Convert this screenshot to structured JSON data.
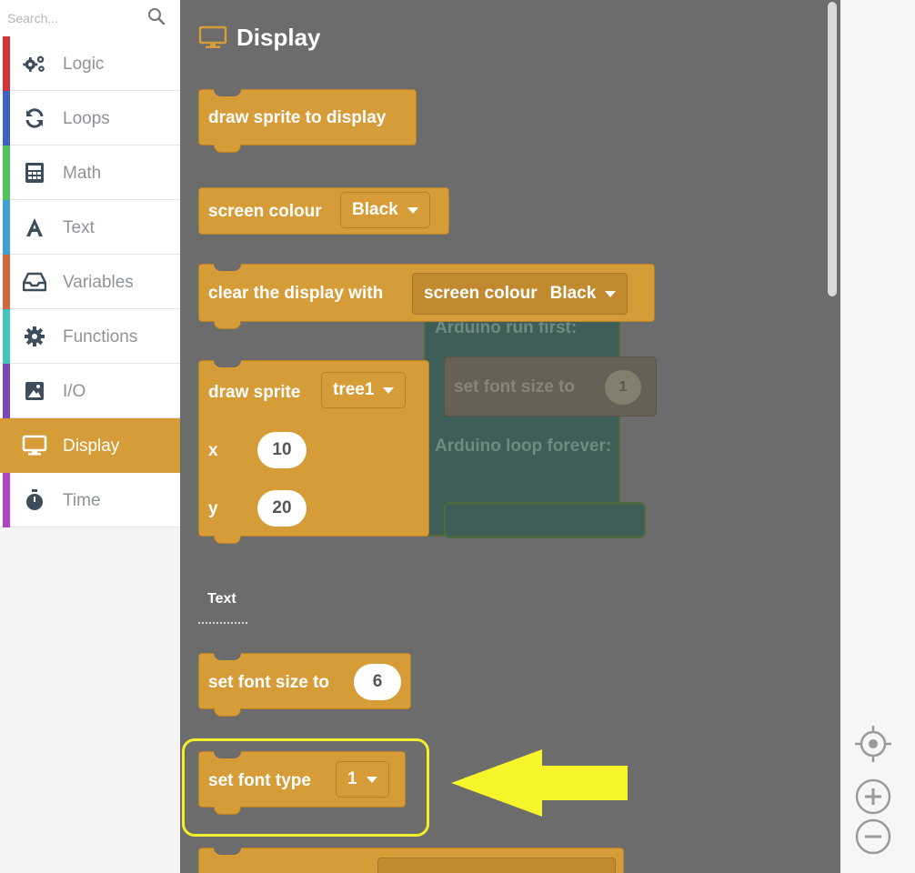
{
  "search": {
    "placeholder": "Search..."
  },
  "categories": [
    {
      "label": "Logic",
      "icon": "gears-icon",
      "color": "#d4323a"
    },
    {
      "label": "Loops",
      "icon": "refresh-icon",
      "color": "#3b62c7"
    },
    {
      "label": "Math",
      "icon": "calculator-icon",
      "color": "#52c45a"
    },
    {
      "label": "Text",
      "icon": "font-icon",
      "color": "#3fa0d4"
    },
    {
      "label": "Variables",
      "icon": "inbox-icon",
      "color": "#d0693a"
    },
    {
      "label": "Functions",
      "icon": "gear-icon",
      "color": "#3fc7c1"
    },
    {
      "label": "I/O",
      "icon": "image-icon",
      "color": "#7d45b8"
    },
    {
      "label": "Display",
      "icon": "desktop-icon",
      "color": "#d69c38",
      "active": true
    },
    {
      "label": "Time",
      "icon": "stopwatch-icon",
      "color": "#b046c2"
    }
  ],
  "flyout": {
    "title": "Display",
    "blocks": {
      "draw_sprite_to_display": "draw sprite to display",
      "screen_colour": {
        "label": "screen colour",
        "value": "Black"
      },
      "clear_display": {
        "label": "clear the display with",
        "inner_label": "screen colour",
        "inner_value": "Black"
      },
      "draw_sprite": {
        "label": "draw sprite",
        "sprite": "tree1",
        "x_label": "x",
        "x_value": "10",
        "y_label": "y",
        "y_value": "20"
      },
      "set_font_size": {
        "label": "set font size to",
        "value": "6"
      },
      "set_font_type": {
        "label": "set font type",
        "value": "1"
      }
    },
    "section_text": "Text"
  },
  "workspace_ghost": {
    "run_first": "Arduino run first:",
    "set_font_size": "set font size to",
    "set_font_size_value": "1",
    "loop_forever": "Arduino loop forever:"
  },
  "colors": {
    "block": "#d69c38",
    "flyout_bg": "#6c6c6c",
    "highlight": "#f3ee2a",
    "arrow": "#f6f42a"
  }
}
